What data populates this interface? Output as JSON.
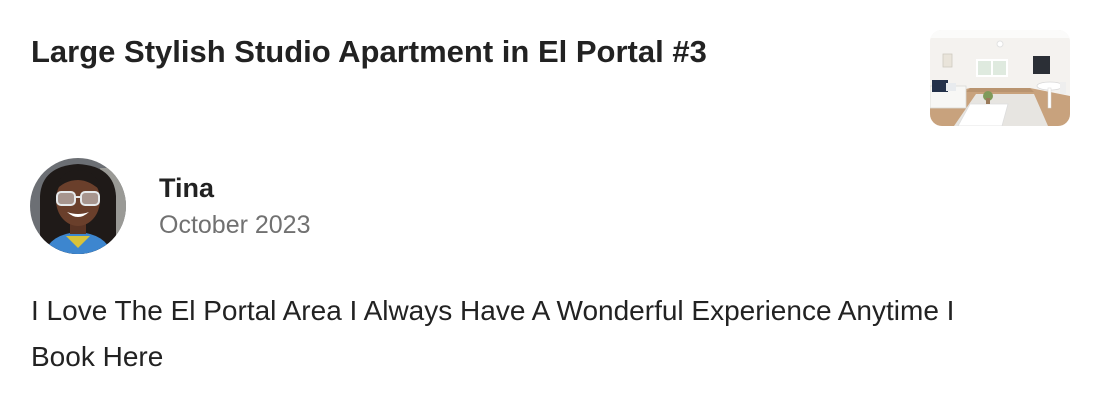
{
  "listing": {
    "title": "Large Stylish Studio Apartment in El Portal #3",
    "thumbnail_icon": "apartment-photo"
  },
  "review": {
    "reviewer_name": "Tina",
    "date": "October 2023",
    "avatar_icon": "reviewer-photo",
    "text": "I Love The El Portal Area I Always Have A Wonderful Experience Anytime I Book Here"
  },
  "colors": {
    "text_primary": "#222222",
    "text_secondary": "#717171",
    "background": "#ffffff"
  }
}
